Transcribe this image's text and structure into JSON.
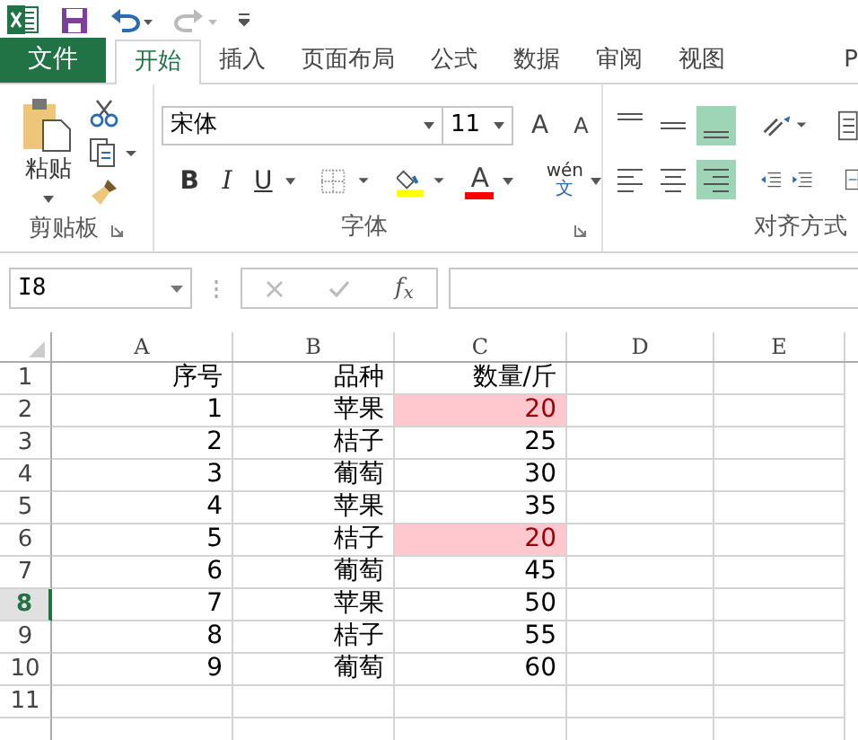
{
  "ribbon_tabs": [
    {
      "label": "文件",
      "kind": "backstage",
      "selected": false
    },
    {
      "label": "开始",
      "kind": "tab",
      "selected": true
    },
    {
      "label": "插入",
      "kind": "tab",
      "selected": false
    },
    {
      "label": "页面布局",
      "kind": "tab",
      "selected": false
    },
    {
      "label": "公式",
      "kind": "tab",
      "selected": false
    },
    {
      "label": "数据",
      "kind": "tab",
      "selected": false
    },
    {
      "label": "审阅",
      "kind": "tab",
      "selected": false
    },
    {
      "label": "视图",
      "kind": "tab",
      "selected": false
    },
    {
      "label": "P",
      "kind": "tab",
      "selected": false
    }
  ],
  "clipboard": {
    "paste_label": "粘贴",
    "group_label": "剪贴板"
  },
  "font": {
    "name": "宋体",
    "size": "11",
    "grow": "A",
    "shrink": "A",
    "bold": "B",
    "italic": "I",
    "underline": "U",
    "font_color": "A",
    "phonetic_top": "wén",
    "phonetic_bottom": "文",
    "group_label": "字体"
  },
  "alignment": {
    "vertical": [
      {
        "selected": false
      },
      {
        "selected": false
      },
      {
        "selected": true
      }
    ],
    "horizontal": [
      {
        "selected": false
      },
      {
        "selected": false
      },
      {
        "selected": true
      }
    ],
    "group_label": "对齐方式"
  },
  "formula_bar": {
    "name_box": "I8",
    "function_label": "f$_{x}$"
  },
  "sheet": {
    "columns": [
      "A",
      "B",
      "C",
      "D",
      "E"
    ],
    "rows": [
      {
        "number": "1",
        "selected": false,
        "cells": [
          {
            "text": "序号",
            "highlighted": false
          },
          {
            "text": "品种",
            "highlighted": false
          },
          {
            "text": "数量/斤",
            "highlighted": false
          }
        ]
      },
      {
        "number": "2",
        "selected": false,
        "cells": [
          {
            "text": "1",
            "highlighted": false
          },
          {
            "text": "苹果",
            "highlighted": false
          },
          {
            "text": "20",
            "highlighted": true
          }
        ]
      },
      {
        "number": "3",
        "selected": false,
        "cells": [
          {
            "text": "2",
            "highlighted": false
          },
          {
            "text": "桔子",
            "highlighted": false
          },
          {
            "text": "25",
            "highlighted": false
          }
        ]
      },
      {
        "number": "4",
        "selected": false,
        "cells": [
          {
            "text": "3",
            "highlighted": false
          },
          {
            "text": "葡萄",
            "highlighted": false
          },
          {
            "text": "30",
            "highlighted": false
          }
        ]
      },
      {
        "number": "5",
        "selected": false,
        "cells": [
          {
            "text": "4",
            "highlighted": false
          },
          {
            "text": "苹果",
            "highlighted": false
          },
          {
            "text": "35",
            "highlighted": false
          }
        ]
      },
      {
        "number": "6",
        "selected": false,
        "cells": [
          {
            "text": "5",
            "highlighted": false
          },
          {
            "text": "桔子",
            "highlighted": false
          },
          {
            "text": "20",
            "highlighted": true
          }
        ]
      },
      {
        "number": "7",
        "selected": false,
        "cells": [
          {
            "text": "6",
            "highlighted": false
          },
          {
            "text": "葡萄",
            "highlighted": false
          },
          {
            "text": "45",
            "highlighted": false
          }
        ]
      },
      {
        "number": "8",
        "selected": true,
        "cells": [
          {
            "text": "7",
            "highlighted": false
          },
          {
            "text": "苹果",
            "highlighted": false
          },
          {
            "text": "50",
            "highlighted": false
          }
        ]
      },
      {
        "number": "9",
        "selected": false,
        "cells": [
          {
            "text": "8",
            "highlighted": false
          },
          {
            "text": "桔子",
            "highlighted": false
          },
          {
            "text": "55",
            "highlighted": false
          }
        ]
      },
      {
        "number": "10",
        "selected": false,
        "cells": [
          {
            "text": "9",
            "highlighted": false
          },
          {
            "text": "葡萄",
            "highlighted": false
          },
          {
            "text": "60",
            "highlighted": false
          }
        ]
      },
      {
        "number": "11",
        "selected": false,
        "cells": []
      }
    ]
  }
}
